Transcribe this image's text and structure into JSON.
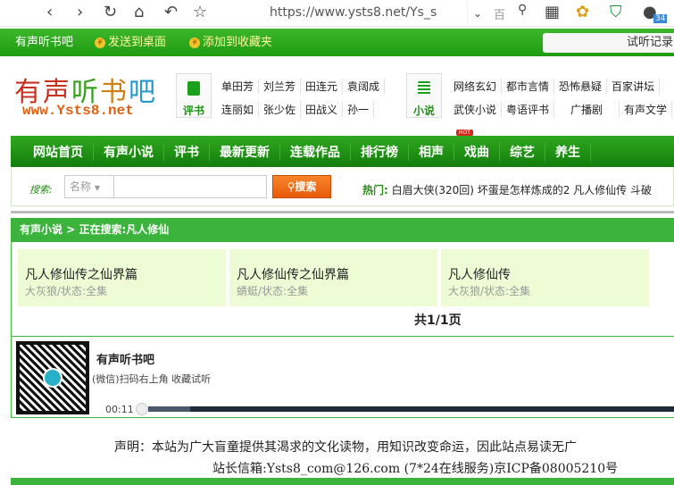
{
  "browser": {
    "url": "https://www.ysts8.net/Ys_s",
    "badge": "34",
    "search_engine": "百"
  },
  "topbar": {
    "site": "有声听书吧",
    "send_desktop": "发送到桌面",
    "add_favorite": "添加到收藏夹",
    "history": "试听记录"
  },
  "logo": {
    "name": "有声听书吧",
    "domain": "www.Ysts8.net"
  },
  "pingshu": {
    "label": "评书",
    "links": [
      "单田芳",
      "刘兰芳",
      "田连元",
      "袁阔成",
      "连丽如",
      "张少佐",
      "田战义",
      "孙一"
    ]
  },
  "xiaoshuo": {
    "label": "小说",
    "links": [
      "网络玄幻",
      "都市言情",
      "恐怖悬疑",
      "百家讲坛",
      "武侠小说",
      "粤语评书",
      "广播剧",
      "有声文学"
    ]
  },
  "nav": [
    "网站首页",
    "有声小说",
    "评书",
    "最新更新",
    "连载作品",
    "排行榜",
    "相声",
    "戏曲",
    "综艺",
    "养生"
  ],
  "hot_badge": "HOT",
  "search": {
    "label": "搜索:",
    "select": "名称",
    "button": "搜索",
    "hot_label": "热门:",
    "hot_items": "白眉大侠(320回) 坏蛋是怎样炼成的2 凡人修仙传 斗破"
  },
  "breadcrumb": {
    "section": "有声小说",
    "sep": ">",
    "current": "正在搜索:凡人修仙"
  },
  "results": [
    {
      "title": "凡人修仙传之仙界篇",
      "meta": "大灰狼/状态:全集"
    },
    {
      "title": "凡人修仙传之仙界篇",
      "meta": "蜻蜓/状态:全集"
    },
    {
      "title": "凡人修仙传",
      "meta": "大灰狼/状态:全集"
    }
  ],
  "pagination": "共1/1页",
  "player": {
    "title": "有声听书吧",
    "subtitle": "(微信)扫码右上角 收藏试听",
    "time": "00:11",
    "progress": 0.08
  },
  "footer": {
    "declaration": "声明：本站为广大盲童提供其渴求的文化读物，用知识改变命运，因此站点易读无广",
    "contact": "站长信箱:Ysts8_com@126.com (7*24在线服务)京ICP备08005210号"
  }
}
